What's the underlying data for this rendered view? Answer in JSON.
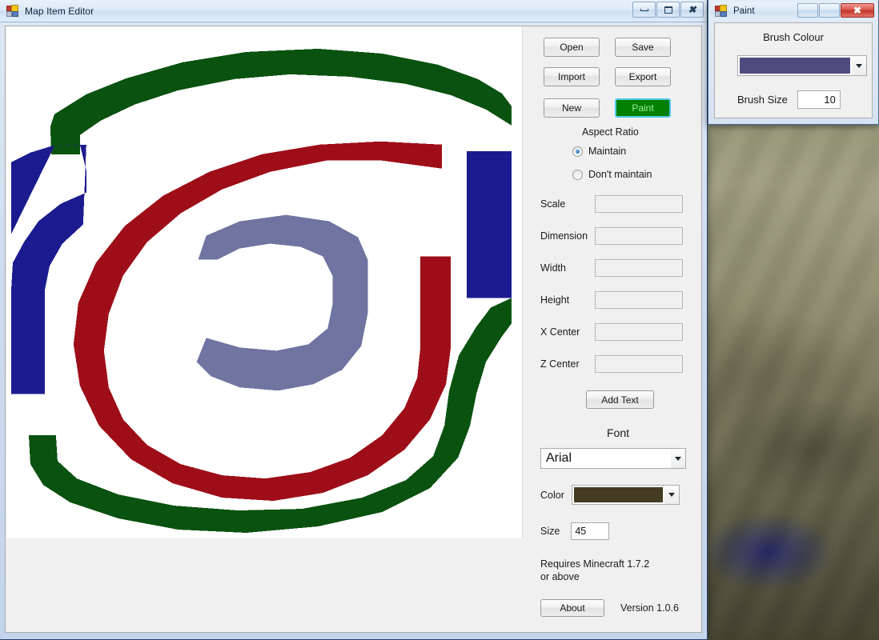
{
  "desktop": {
    "description": "blurred minecraft terrain"
  },
  "main_window": {
    "title": "Map Item Editor",
    "icon": "app-icon",
    "controls": {
      "minimize": "minimize-icon",
      "maximize": "maximize-icon",
      "close": "close-icon"
    }
  },
  "toolbar": {
    "open_label": "Open",
    "save_label": "Save",
    "import_label": "Import",
    "export_label": "Export",
    "new_label": "New",
    "paint_label": "Paint"
  },
  "aspect_ratio": {
    "title": "Aspect Ratio",
    "maintain_label": "Maintain",
    "dont_maintain_label": "Don't maintain",
    "selected": "Maintain"
  },
  "fields": [
    {
      "label": "Scale",
      "value": ""
    },
    {
      "label": "Dimension",
      "value": ""
    },
    {
      "label": "Width",
      "value": ""
    },
    {
      "label": "Height",
      "value": ""
    },
    {
      "label": "X Center",
      "value": ""
    },
    {
      "label": "Z Center",
      "value": ""
    }
  ],
  "text_tools": {
    "add_text_label": "Add Text",
    "font_title": "Font",
    "font_value": "Arial",
    "color_label": "Color",
    "color_value": "#443B23",
    "size_label": "Size",
    "size_value": "45"
  },
  "footer": {
    "requires_line1": "Requires Minecraft 1.7.2",
    "requires_line2": "or above",
    "about_label": "About",
    "version_label": "Version 1.0.6"
  },
  "paint_dialog": {
    "title": "Paint",
    "brush_colour_label": "Brush Colour",
    "brush_colour_value": "#4E4C7E",
    "brush_size_label": "Brush Size",
    "brush_size_value": "10",
    "controls": {
      "minimize": "minimize-icon",
      "maximize": "maximize-icon",
      "close": "close-icon"
    }
  },
  "canvas": {
    "background": "#FFFFFF",
    "colors": {
      "green": "#0A5210",
      "blue": "#1B1B8F",
      "red": "#9E0E18",
      "slate": "#6F74A0"
    }
  },
  "colors": {
    "paint_button_fill": "#008000",
    "paint_button_border": "#4EC8E8",
    "paint_button_text": "#9DF09D"
  }
}
